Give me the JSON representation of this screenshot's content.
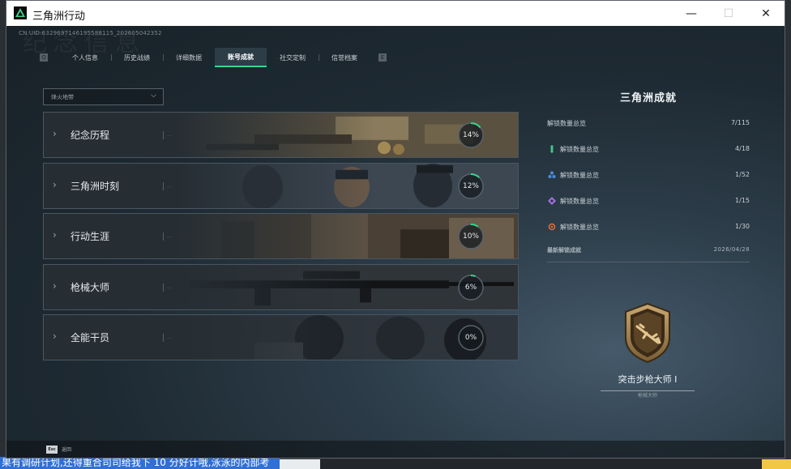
{
  "window": {
    "title": "三角洲行动",
    "minimize": "—",
    "maximize": "☐",
    "close": "✕"
  },
  "uid_text": "CN UID:6329697146195588115_202605042352",
  "watermark": "纪念信息",
  "tabs": [
    {
      "label": "个人信息",
      "active": false
    },
    {
      "label": "历史战绩",
      "active": false
    },
    {
      "label": "详细数据",
      "active": false
    },
    {
      "label": "账号成就",
      "active": true
    },
    {
      "label": "社交定制",
      "active": false
    },
    {
      "label": "信誉档案",
      "active": false
    }
  ],
  "tab_prev_key": "Q",
  "tab_next_key": "E",
  "filter": {
    "value": "烽火地带"
  },
  "categories": [
    {
      "name": "纪念历程",
      "en": "...",
      "progress_label": "14%",
      "progress": 0.14,
      "art": "items"
    },
    {
      "name": "三角洲时刻",
      "en": "...",
      "progress_label": "12%",
      "progress": 0.12,
      "art": "soldiers"
    },
    {
      "name": "行动生涯",
      "en": "...",
      "progress_label": "10%",
      "progress": 0.1,
      "art": "ruins"
    },
    {
      "name": "枪械大师",
      "en": "...",
      "progress_label": "6%",
      "progress": 0.06,
      "art": "gun"
    },
    {
      "name": "全能干员",
      "en": "...",
      "progress_label": "0%",
      "progress": 0.0,
      "art": "operators"
    }
  ],
  "panel": {
    "title": "三角洲成就",
    "total": {
      "label": "解锁数量总览",
      "value": "7/115"
    },
    "tiers": [
      {
        "label": "解锁数量总览",
        "value": "4/18",
        "icon": "green-dots-icon",
        "color": "#3dcf88"
      },
      {
        "label": "解锁数量总览",
        "value": "1/52",
        "icon": "blue-cluster-icon",
        "color": "#4a8fe0"
      },
      {
        "label": "解锁数量总览",
        "value": "1/15",
        "icon": "purple-diamond-icon",
        "color": "#a06ee0"
      },
      {
        "label": "解锁数量总览",
        "value": "1/30",
        "icon": "orange-crosshair-icon",
        "color": "#e0703a"
      }
    ],
    "recent": {
      "label": "最新解锁成就",
      "date": "2026/04/28"
    },
    "badge": {
      "name": "突击步枪大师 I",
      "sub": "枪械大师"
    }
  },
  "footer": {
    "key": "Esc",
    "label": "返回"
  },
  "desktop_text": "果有调研计划,还得重合司司给我下 10 分好计哦,泳泳的内部考",
  "colors": {
    "accent": "#37d68a",
    "ring": "#37d68a"
  }
}
